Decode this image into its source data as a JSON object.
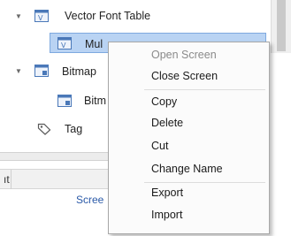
{
  "tree": {
    "items": [
      {
        "label": "Vector Font Table",
        "icon": "font-table-icon",
        "expanded": true
      },
      {
        "label": "Mul",
        "icon": "font-table-icon",
        "selected": true
      },
      {
        "label": "Bitmap",
        "icon": "bitmap-table-icon",
        "expanded": true
      },
      {
        "label": "Bitm",
        "icon": "bitmap-table-icon"
      },
      {
        "label": "Tag",
        "icon": "tag-icon"
      }
    ]
  },
  "grid": {
    "header_label": "ıt",
    "cell_text": "Scree"
  },
  "context_menu": {
    "items": [
      {
        "label": "Open Screen",
        "enabled": false
      },
      {
        "label": "Close Screen",
        "enabled": true
      },
      {
        "label": "Copy",
        "enabled": true
      },
      {
        "label": "Delete",
        "enabled": true
      },
      {
        "label": "Cut",
        "enabled": true
      },
      {
        "label": "Change Name",
        "enabled": true
      },
      {
        "label": "Export",
        "enabled": true
      },
      {
        "label": "Import",
        "enabled": true
      }
    ]
  },
  "colors": {
    "selection": "#b9d3f3",
    "selection_border": "#7ea9df",
    "icon_blue": "#4a78b8",
    "disabled_text": "#8a8a8a"
  }
}
